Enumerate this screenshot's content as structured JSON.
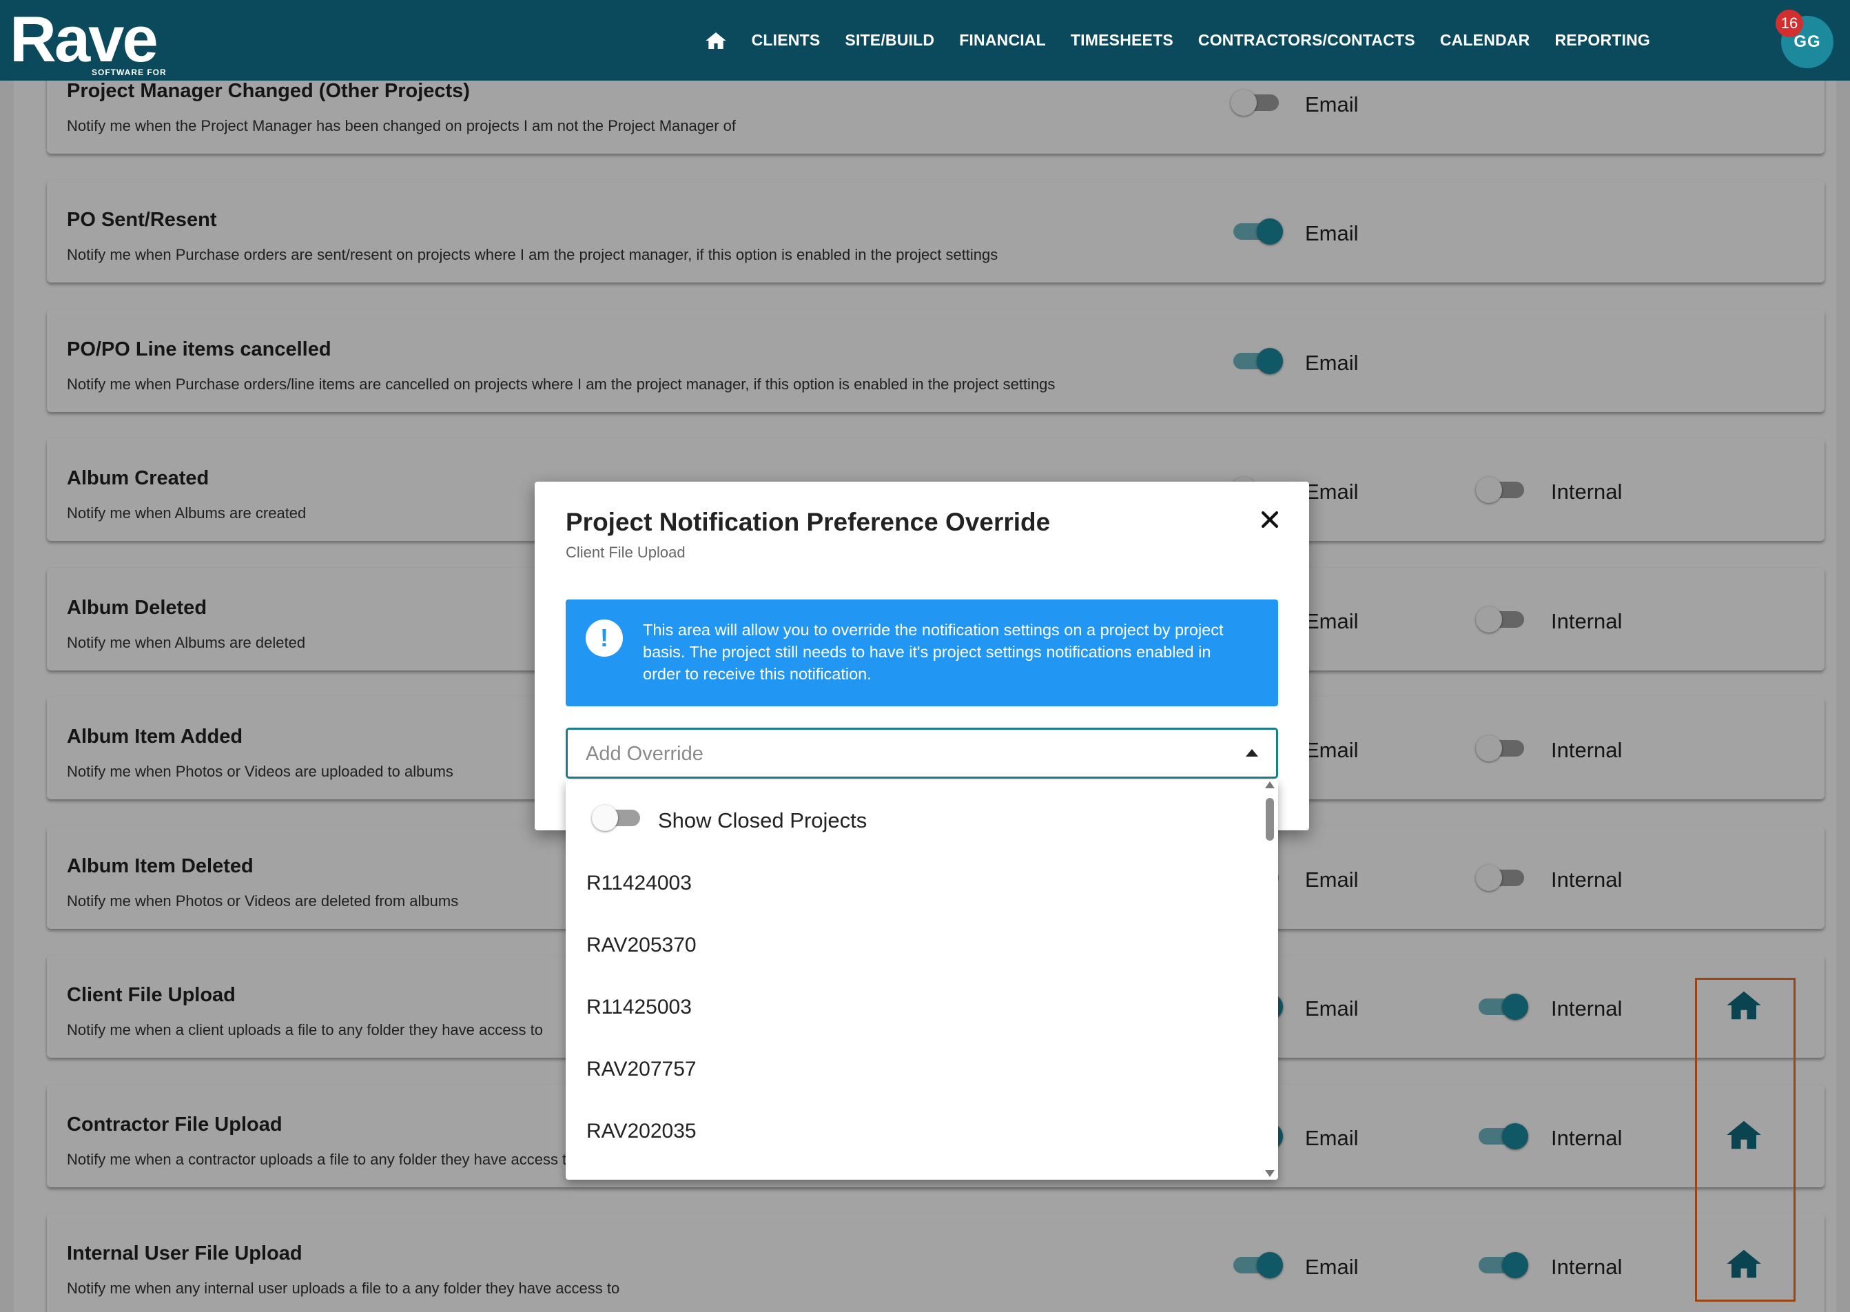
{
  "header": {
    "logo": "Rave",
    "logo_sub": "SOFTWARE FOR",
    "home_icon": "home-icon",
    "nav": [
      "CLIENTS",
      "SITE/BUILD",
      "FINANCIAL",
      "TIMESHEETS",
      "CONTRACTORS/CONTACTS",
      "CALENDAR",
      "REPORTING"
    ],
    "notification_count": "16",
    "avatar_initials": "GG"
  },
  "colors": {
    "brand": "#0b4a5c",
    "accent": "#1a8aa0",
    "info": "#2196f3",
    "highlight": "#f26b21",
    "badge": "#d32f2f"
  },
  "labels": {
    "email": "Email",
    "internal": "Internal"
  },
  "rows": [
    {
      "title": "Project Manager Changed (Other Projects)",
      "desc": "Notify me when the Project Manager has been changed on projects I am not the Project Manager of",
      "email_on": false
    },
    {
      "title": "PO Sent/Resent",
      "desc": "Notify me when Purchase orders are sent/resent on projects where I am the project manager, if this option is enabled in the project settings",
      "email_on": true
    },
    {
      "title": "PO/PO Line items cancelled",
      "desc": "Notify me when Purchase orders/line items are cancelled on projects where I am the project manager, if this option is enabled in the project settings",
      "email_on": true
    },
    {
      "title": "Album Created",
      "desc": "Notify me when Albums are created",
      "email_on": false,
      "internal_on": false
    },
    {
      "title": "Album Deleted",
      "desc": "Notify me when Albums are deleted",
      "email_on": false,
      "internal_on": false
    },
    {
      "title": "Album Item Added",
      "desc": "Notify me when Photos or Videos are uploaded to albums",
      "email_on": false,
      "internal_on": false
    },
    {
      "title": "Album Item Deleted",
      "desc": "Notify me when Photos or Videos are deleted from albums",
      "email_on": false,
      "internal_on": false
    },
    {
      "title": "Client File Upload",
      "desc": "Notify me when a client uploads a file to any folder they have access to",
      "email_on": true,
      "internal_on": true
    },
    {
      "title": "Contractor File Upload",
      "desc": "Notify me when a contractor uploads a file to any folder they have access to",
      "email_on": true,
      "internal_on": true
    },
    {
      "title": "Internal User File Upload",
      "desc": "Notify me when any internal user uploads a file to a any folder they have access to",
      "email_on": true,
      "internal_on": true
    }
  ],
  "modal": {
    "title": "Project Notification Preference Override",
    "subtitle": "Client File Upload",
    "close_icon": "close-icon",
    "info_icon": "exclamation-icon",
    "info_text": "This area will allow you to override the notification settings on a project by project basis. The project still needs to have it's project settings notifications enabled in order to receive this notification.",
    "select_placeholder": "Add Override"
  },
  "dropdown": {
    "show_closed_label": "Show Closed Projects",
    "show_closed_on": false,
    "items": [
      "R11424003",
      "RAV205370",
      "R11425003",
      "RAV207757",
      "RAV202035"
    ]
  }
}
